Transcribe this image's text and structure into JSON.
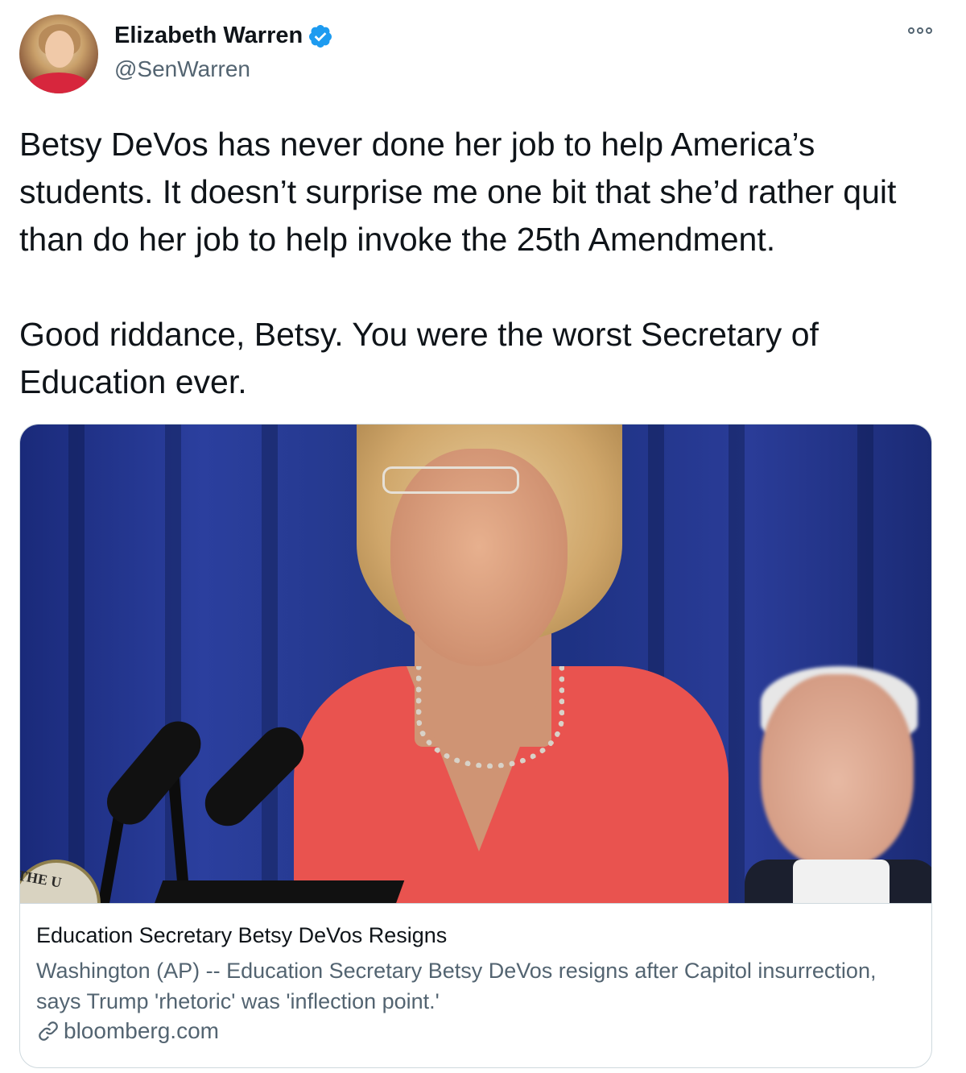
{
  "author": {
    "display_name": "Elizabeth Warren",
    "handle": "@SenWarren",
    "verified": true,
    "verified_color": "#1d9bf0"
  },
  "tweet": {
    "text": "Betsy DeVos has never done her job to help America’s students. It doesn’t surprise me one bit that she’d rather quit than do her job to help invoke the 25th Amendment.\n\nGood riddance, Betsy. You were the worst Secretary of Education ever."
  },
  "link_card": {
    "image_seal_text": "THE U",
    "title": "Education Secretary Betsy DeVos Resigns",
    "description": "Washington (AP) -- Education Secretary Betsy DeVos resigns after Capitol insurrection, says Trump 'rhetoric' was 'inflection point.'",
    "domain": "bloomberg.com"
  },
  "icons": {
    "verified": "verified-badge-icon",
    "more": "more-options-icon",
    "link": "link-icon"
  },
  "colors": {
    "text_primary": "#0f1419",
    "text_secondary": "#536471",
    "border": "#cfd9de",
    "dress": "#e9534f",
    "curtain": "#23378a"
  }
}
